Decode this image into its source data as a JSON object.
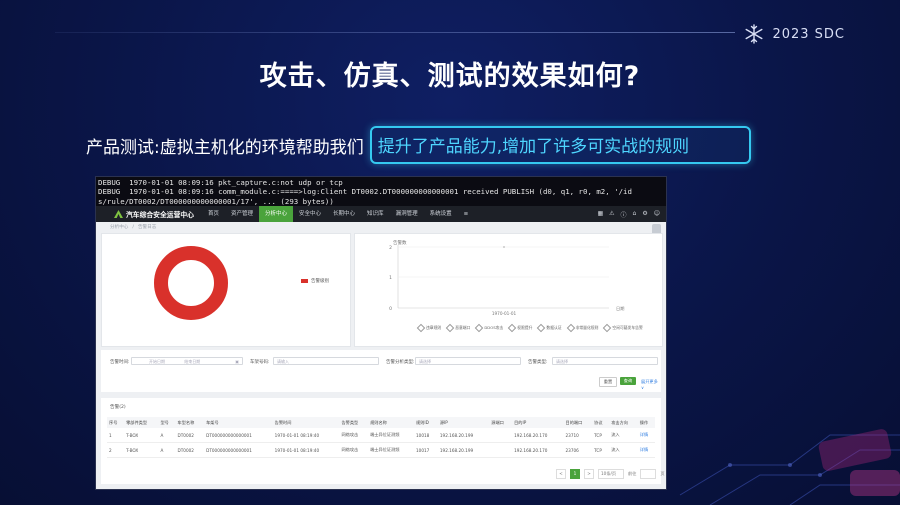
{
  "brand": {
    "text": "2023 SDC"
  },
  "slide": {
    "title": "攻击、仿真、测试的效果如何?",
    "subtitle_prefix": "产品测试:虚拟主机化的环境帮助我们",
    "subtitle_highlight": "提升了产品能力,增加了许多可实战的规则"
  },
  "console": {
    "lines": [
      "DEBUG  1970-01-01 08:09:16 pkt_capture.c:not udp or tcp",
      "DEBUG  1970-01-01 08:09:16 comm_module.c:====>log:Client DT0002.DT000000000000001 received PUBLISH (d0, q1, r0, m2, '/id",
      "s/rule/DT0002/DT000000000000001/17', ... (293 bytes))"
    ]
  },
  "app": {
    "name": "汽车综合安全运营中心",
    "nav": [
      "首页",
      "资产管理",
      "分析中心",
      "安全中心",
      "长期中心",
      "知识库",
      "漏洞管理",
      "系统设置"
    ],
    "active_nav": "分析中心",
    "menu_icon": "≡",
    "breadcrumb": [
      "分析中心",
      "/",
      "告警日志"
    ]
  },
  "donut": {
    "legend": "告警级别",
    "color": "#d9312b"
  },
  "line_chart": {
    "y_title": "告警数",
    "y_ticks": [
      "2",
      "1",
      "0"
    ],
    "x_tick": "1970-01-01",
    "x_title": "日期",
    "legend": [
      "违章规则",
      "恶意端口",
      "DDOS攻击",
      "权限提升",
      "数据认证",
      "非常量化规则",
      "空闲可疑发车告警"
    ]
  },
  "filters": {
    "time_label": "告警时间:",
    "start_placeholder": "开始日期",
    "end_placeholder": "结束日期",
    "vin_label": "车架号码:",
    "vin_placeholder": "请输入",
    "attack_label": "告警分析类型:",
    "attack_placeholder": "请选择",
    "type_label": "告警类型:",
    "type_placeholder": "请选择",
    "reset": "重置",
    "search": "查询",
    "expand": "展开更多 ∨"
  },
  "table": {
    "count": "告警(2)",
    "headers": [
      "序号",
      "零部件类型",
      "型号",
      "车型名称",
      "车架号",
      "告警时间",
      "告警类型",
      "规则名称",
      "规则ID",
      "源IP",
      "源端口",
      "目的IP",
      "目的端口",
      "协议",
      "攻击方向",
      "操作"
    ],
    "rows": [
      [
        "1",
        "T-BOX",
        "A",
        "DT0002",
        "DT000000000000001",
        "1970-01-01 08:19:40",
        "网络攻击",
        "端士异位证测频",
        "10018",
        "192.168.20.199",
        "",
        "192.168.20.170",
        "23710",
        "TCP",
        "流入",
        "详情"
      ],
      [
        "2",
        "T-BOX",
        "A",
        "DT0002",
        "DT000000000000001",
        "1970-01-01 08:19:40",
        "网络攻击",
        "端士异位证测频",
        "10017",
        "192.168.20.199",
        "",
        "192.168.20.170",
        "23706",
        "TCP",
        "流入",
        "详情"
      ]
    ]
  },
  "pager": {
    "prev": "<",
    "current": "1",
    "next": ">",
    "size": "10条/页",
    "goto": "前往",
    "page_unit": "页"
  }
}
